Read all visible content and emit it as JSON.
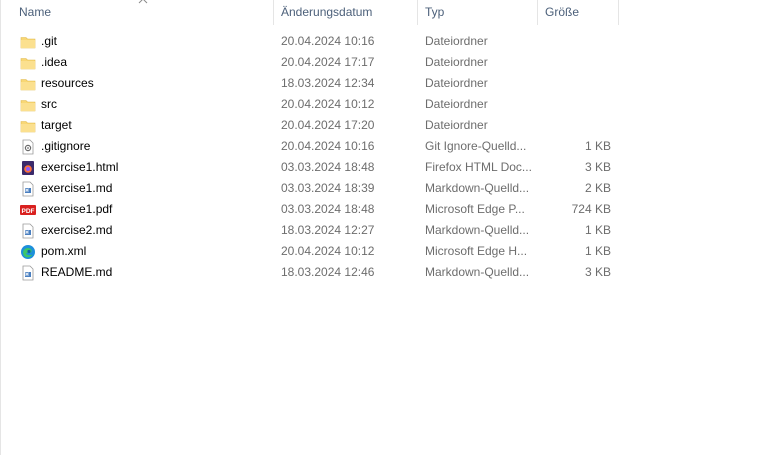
{
  "columns": {
    "name": "Name",
    "date": "Änderungsdatum",
    "type": "Typ",
    "size": "Größe"
  },
  "files": [
    {
      "name": ".git",
      "date": "20.04.2024 10:16",
      "type": "Dateiordner",
      "size": "",
      "icon": "folder-icon"
    },
    {
      "name": ".idea",
      "date": "20.04.2024 17:17",
      "type": "Dateiordner",
      "size": "",
      "icon": "folder-icon"
    },
    {
      "name": "resources",
      "date": "18.03.2024 12:34",
      "type": "Dateiordner",
      "size": "",
      "icon": "folder-icon"
    },
    {
      "name": "src",
      "date": "20.04.2024 10:12",
      "type": "Dateiordner",
      "size": "",
      "icon": "folder-icon"
    },
    {
      "name": "target",
      "date": "20.04.2024 17:20",
      "type": "Dateiordner",
      "size": "",
      "icon": "folder-icon"
    },
    {
      "name": ".gitignore",
      "date": "20.04.2024 10:16",
      "type": "Git Ignore-Quelld...",
      "size": "1 KB",
      "icon": "gear-file-icon"
    },
    {
      "name": "exercise1.html",
      "date": "03.03.2024 18:48",
      "type": "Firefox HTML Doc...",
      "size": "3 KB",
      "icon": "firefox-html-icon"
    },
    {
      "name": "exercise1.md",
      "date": "03.03.2024 18:39",
      "type": "Markdown-Quelld...",
      "size": "2 KB",
      "icon": "markdown-file-icon"
    },
    {
      "name": "exercise1.pdf",
      "date": "03.03.2024 18:48",
      "type": "Microsoft Edge P...",
      "size": "724 KB",
      "icon": "pdf-icon"
    },
    {
      "name": "exercise2.md",
      "date": "18.03.2024 12:27",
      "type": "Markdown-Quelld...",
      "size": "1 KB",
      "icon": "markdown-file-icon"
    },
    {
      "name": "pom.xml",
      "date": "20.04.2024 10:12",
      "type": "Microsoft Edge H...",
      "size": "1 KB",
      "icon": "edge-icon"
    },
    {
      "name": "README.md",
      "date": "18.03.2024 12:46",
      "type": "Markdown-Quelld...",
      "size": "3 KB",
      "icon": "markdown-file-icon"
    }
  ],
  "colors": {
    "folder": "#f8d775",
    "header_text": "#4c607a",
    "secondary_text": "#6d6d6d",
    "pdf_red": "#d9201f",
    "edge_blue": "#1d8fdb"
  }
}
